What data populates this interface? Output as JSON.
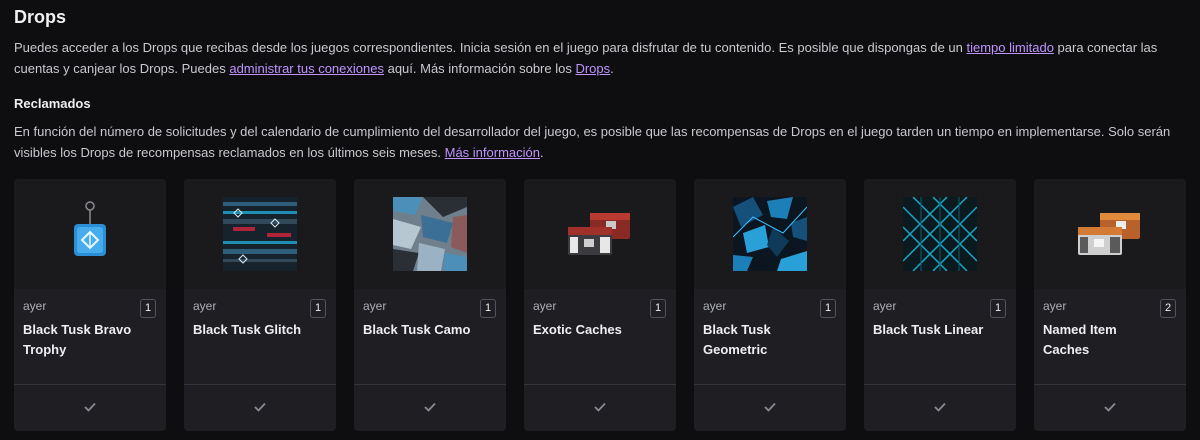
{
  "page": {
    "title": "Drops",
    "intro": {
      "part1": "Puedes acceder a los Drops que recibas desde los juegos correspondientes. Inicia sesión en el juego para disfrutar de tu contenido. Es posible que dispongas de un ",
      "link1": "tiempo limitado",
      "part2": " para conectar las cuentas y canjear los Drops. Puedes ",
      "link2": "administrar tus conexiones",
      "part3": " aquí. Más información sobre los ",
      "link3": "Drops",
      "part4": "."
    },
    "claimed": {
      "heading": "Reclamados",
      "text": "En función del número de solicitudes y del calendario de cumplimiento del desarrollador del juego, es posible que las recompensas de Drops en el juego tarden un tiempo en implementarse. Solo serán visibles los Drops de recompensas reclamados en los últimos seis meses. ",
      "link": "Más información",
      "end": "."
    }
  },
  "drops": [
    {
      "date": "ayer",
      "qty": "1",
      "name": "Black Tusk Bravo Trophy",
      "icon": "trophy-icon"
    },
    {
      "date": "ayer",
      "qty": "1",
      "name": "Black Tusk Glitch",
      "icon": "glitch-pattern-icon"
    },
    {
      "date": "ayer",
      "qty": "1",
      "name": "Black Tusk Camo",
      "icon": "camo-pattern-icon"
    },
    {
      "date": "ayer",
      "qty": "1",
      "name": "Exotic Caches",
      "icon": "exotic-cache-icon"
    },
    {
      "date": "ayer",
      "qty": "1",
      "name": "Black Tusk Geometric",
      "icon": "geometric-pattern-icon"
    },
    {
      "date": "ayer",
      "qty": "1",
      "name": "Black Tusk Linear",
      "icon": "linear-pattern-icon"
    },
    {
      "date": "ayer",
      "qty": "2",
      "name": "Named Item Caches",
      "icon": "named-cache-icon"
    }
  ],
  "colors": {
    "background": "#0e0e10",
    "card": "#1f1f23",
    "link": "#bf94ff"
  }
}
